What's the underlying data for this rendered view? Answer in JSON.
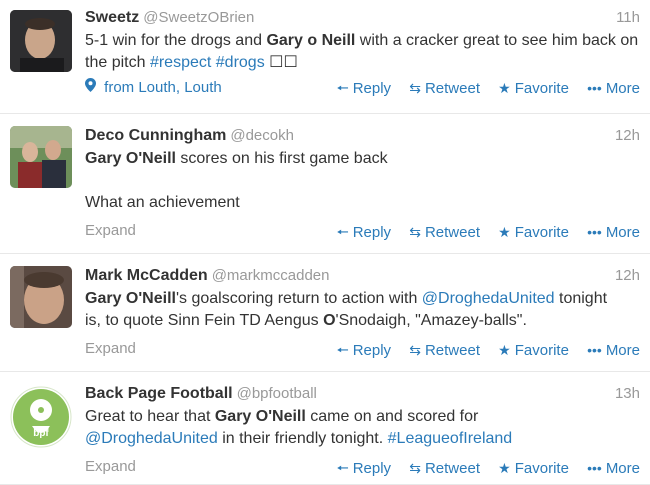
{
  "tweets": [
    {
      "name": "Sweetz",
      "handle": "@SweetzOBrien",
      "time": "11h",
      "text_parts": [
        "5-1 win for the drogs and ",
        "Gary o Neill",
        " with a cracker great to see him back on the pitch ",
        "#respect",
        " ",
        "#drogs",
        " ☐☐"
      ],
      "location": "from Louth, Louth"
    },
    {
      "name": "Deco Cunningham",
      "handle": "@decokh",
      "time": "12h",
      "line1_bold": "Gary O'Neill",
      "line1_rest": " scores on his first game back",
      "line2": "What an achievement",
      "expand": "Expand"
    },
    {
      "name": "Mark McCadden",
      "handle": "@markmccadden",
      "time": "12h",
      "p1_bold": "Gary O'Neill",
      "p1_rest": "'s goalscoring return to action with ",
      "p1_link": "@DroghedaUnited",
      "p1_end": " tonight",
      "p2_start": "is, to quote Sinn Fein TD Aengus ",
      "p2_bold": "O",
      "p2_end": "'Snodaigh, \"Amazey-balls\".",
      "expand": "Expand"
    },
    {
      "name": "Back Page Football",
      "handle": "@bpfootball",
      "time": "13h",
      "p1_start": "Great to hear that ",
      "p1_bold": "Gary O'Neill",
      "p1_end": " came on and scored for",
      "p2_link1": "@DroghedaUnited",
      "p2_mid": " in their friendly tonight. ",
      "p2_link2": "#LeagueofIreland",
      "expand": "Expand",
      "avatar_text": "bpf"
    }
  ],
  "actions": {
    "reply": "Reply",
    "retweet": "Retweet",
    "favorite": "Favorite",
    "more": "More"
  },
  "icons": [
    "reply-icon",
    "retweet-icon",
    "star-icon",
    "more-icon",
    "location-pin-icon"
  ],
  "colors": {
    "link": "#2b7bb9",
    "muted": "#999999",
    "text": "#333333"
  }
}
